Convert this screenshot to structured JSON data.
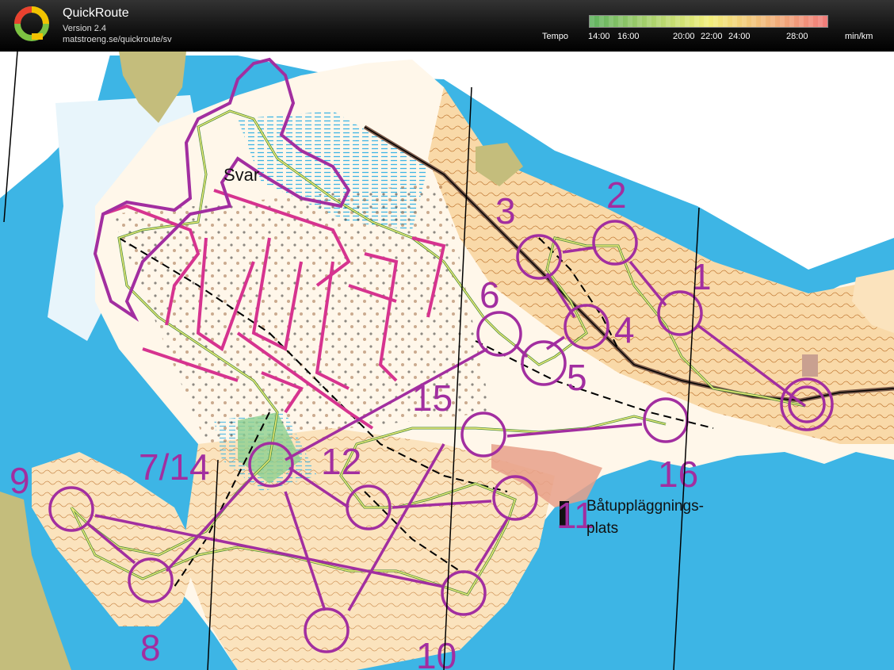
{
  "header": {
    "app_name": "QuickRoute",
    "version": "Version 2.4",
    "url": "matstroeng.se/quickroute/sv",
    "legend_label": "Tempo",
    "unit": "min/km",
    "ticks": [
      "14:00",
      "16:00",
      "20:00",
      "22:00",
      "24:00",
      "28:00"
    ],
    "colors": {
      "slow": "#f07a7a",
      "mid": "#f2ef7a",
      "fast": "#5fb25f"
    }
  },
  "map": {
    "place_name": "Svar",
    "place_label_line1": "Båtuppläggnings-",
    "place_label_line2": "plats",
    "course_color": "#a22ea0",
    "water_color": "#3db5e5",
    "controls": [
      "1",
      "2",
      "3",
      "4",
      "5",
      "6",
      "7/14",
      "8",
      "9",
      "10",
      "11",
      "12",
      "15",
      "16"
    ]
  }
}
